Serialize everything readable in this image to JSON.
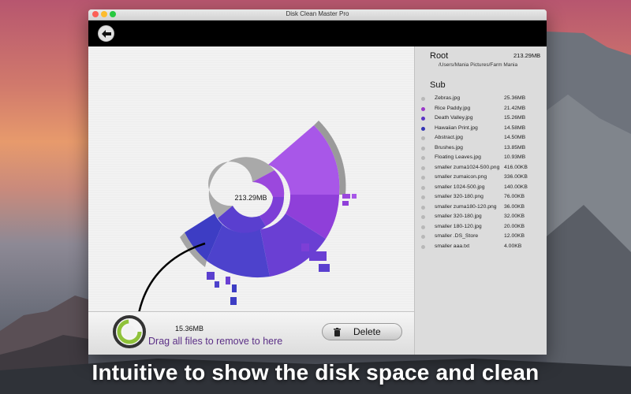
{
  "window": {
    "title": "Disk Clean Master Pro"
  },
  "toolbar": {
    "back_icon": "arrow-left-icon"
  },
  "chart": {
    "center_size": "213.29MB"
  },
  "dropzone": {
    "size": "15.36MB",
    "hint": "Drag all files to remove to here"
  },
  "actions": {
    "delete_label": "Delete"
  },
  "sidebar": {
    "root_heading": "Root",
    "root_size": "213.29MB",
    "root_path": "/Users/Mania Pictures/Farm Mania",
    "sub_heading": "Sub",
    "files": [
      {
        "name": "Zebras.jpg",
        "size": "25.36MB",
        "color": "#b8b8b8"
      },
      {
        "name": "Rice Paddy.jpg",
        "size": "21.42MB",
        "color": "#9b38c9"
      },
      {
        "name": "Death Valley.jpg",
        "size": "15.26MB",
        "color": "#5a34c4"
      },
      {
        "name": "Hawaiian Print.jpg",
        "size": "14.58MB",
        "color": "#3434b4"
      },
      {
        "name": "Abstract.jpg",
        "size": "14.50MB",
        "color": "#b8b8b8"
      },
      {
        "name": "Brushes.jpg",
        "size": "13.85MB",
        "color": "#b8b8b8"
      },
      {
        "name": "Floating Leaves.jpg",
        "size": "10.93MB",
        "color": "#b8b8b8"
      },
      {
        "name": "smaller zuma1024-500.png",
        "size": "416.00KB",
        "color": "#b8b8b8"
      },
      {
        "name": "smaller zumaicon.png",
        "size": "336.00KB",
        "color": "#b8b8b8"
      },
      {
        "name": "smaller 1024-500.jpg",
        "size": "140.00KB",
        "color": "#b8b8b8"
      },
      {
        "name": "smaller 320-180.png",
        "size": "76.00KB",
        "color": "#b8b8b8"
      },
      {
        "name": "smaller zuma180-120.png",
        "size": "36.00KB",
        "color": "#b8b8b8"
      },
      {
        "name": "smaller 320-180.jpg",
        "size": "32.00KB",
        "color": "#b8b8b8"
      },
      {
        "name": "smaller 180-120.jpg",
        "size": "20.00KB",
        "color": "#b8b8b8"
      },
      {
        "name": "smaller .DS_Store",
        "size": "12.00KB",
        "color": "#b8b8b8"
      },
      {
        "name": "smaller aaa.txt",
        "size": "4.00KB",
        "color": "#b8b8b8"
      }
    ]
  },
  "caption": "Intuitive to show the disk space and clean",
  "colors": {
    "purple_light": "#a857e8",
    "purple": "#8a3fd6",
    "indigo": "#5a3fcf",
    "blue": "#3d3dc4",
    "ring_grey": "#aaaaaa",
    "hint_text": "#5b2f86"
  }
}
